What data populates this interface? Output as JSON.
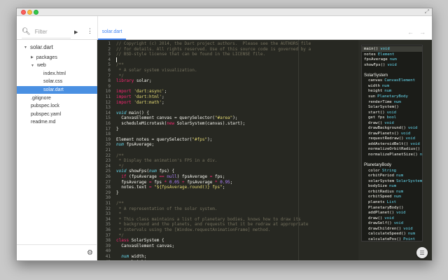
{
  "toolbar": {
    "filter_placeholder": "Filter",
    "search_icon": "search-icon",
    "run_icon": "▶",
    "more_icon": "⋮",
    "nav_back": "←",
    "nav_forward": "→",
    "expand_icon": "⤢"
  },
  "tabs": [
    {
      "label": "solar.dart",
      "active": true
    }
  ],
  "sidebar": {
    "items": [
      {
        "label": "solar.dart",
        "arrow": "▼",
        "level": 0
      },
      {
        "label": "packages",
        "arrow": "▶",
        "level": 1
      },
      {
        "label": "web",
        "arrow": "▼",
        "level": 1
      },
      {
        "label": "index.html",
        "arrow": "",
        "level": 2
      },
      {
        "label": "solar.css",
        "arrow": "",
        "level": 2
      },
      {
        "label": "solar.dart",
        "arrow": "",
        "level": 2,
        "selected": true
      },
      {
        "label": ".gitignore",
        "arrow": "",
        "level": 1
      },
      {
        "label": "pubspec.lock",
        "arrow": "",
        "level": 1
      },
      {
        "label": "pubspec.yaml",
        "arrow": "",
        "level": 1
      },
      {
        "label": "readme.md",
        "arrow": "",
        "level": 1
      }
    ],
    "settings_icon": "⚙"
  },
  "editor": {
    "lines": [
      {
        "n": "1",
        "t": [
          [
            "c-comment",
            "// Copyright (c) 2014, the Dart project authors.  Please see the AUTHORS file"
          ]
        ]
      },
      {
        "n": "2",
        "t": [
          [
            "c-comment",
            "// for details. All rights reserved. Use of this source code is governed by a"
          ]
        ]
      },
      {
        "n": "3",
        "t": [
          [
            "c-comment",
            "// BSD-style license that can be found in the LICENSE file."
          ]
        ]
      },
      {
        "n": "4",
        "t": [],
        "cursor": true
      },
      {
        "n": "5",
        "t": [
          [
            "c-comment",
            "/**"
          ]
        ]
      },
      {
        "n": "6",
        "t": [
          [
            "c-comment",
            " * A solar system visualization."
          ]
        ]
      },
      {
        "n": "7",
        "t": [
          [
            "c-comment",
            " */"
          ]
        ]
      },
      {
        "n": "8",
        "t": [
          [
            "c-kw",
            "library"
          ],
          [
            "c-plain",
            " solar;"
          ]
        ]
      },
      {
        "n": "9",
        "t": []
      },
      {
        "n": "10",
        "t": [
          [
            "c-kw",
            "import"
          ],
          [
            "c-plain",
            " "
          ],
          [
            "c-str",
            "'dart:async'"
          ],
          [
            "c-plain",
            ";"
          ]
        ]
      },
      {
        "n": "11",
        "t": [
          [
            "c-kw",
            "import"
          ],
          [
            "c-plain",
            " "
          ],
          [
            "c-str",
            "'dart:html'"
          ],
          [
            "c-plain",
            ";"
          ]
        ]
      },
      {
        "n": "12",
        "t": [
          [
            "c-kw",
            "import"
          ],
          [
            "c-plain",
            " "
          ],
          [
            "c-str",
            "'dart:math'"
          ],
          [
            "c-plain",
            ";"
          ]
        ]
      },
      {
        "n": "13",
        "t": []
      },
      {
        "n": "14",
        "t": [
          [
            "c-type",
            "void"
          ],
          [
            "c-plain",
            " main() {"
          ]
        ]
      },
      {
        "n": "15",
        "t": [
          [
            "c-plain",
            "  CanvasElement canvas = querySelector("
          ],
          [
            "c-str",
            "\"#area\""
          ],
          [
            "c-plain",
            ");"
          ]
        ]
      },
      {
        "n": "16",
        "t": [
          [
            "c-plain",
            "  scheduleMicrotask("
          ],
          [
            "c-kw",
            "new"
          ],
          [
            "c-plain",
            " SolarSystem(canvas).start);"
          ]
        ]
      },
      {
        "n": "17",
        "t": [
          [
            "c-plain",
            "}"
          ]
        ]
      },
      {
        "n": "18",
        "t": []
      },
      {
        "n": "19",
        "t": [
          [
            "c-plain",
            "Element notes = querySelector("
          ],
          [
            "c-str",
            "\"#fps\""
          ],
          [
            "c-plain",
            ");"
          ]
        ]
      },
      {
        "n": "20",
        "t": [
          [
            "c-type",
            "num"
          ],
          [
            "c-plain",
            " fpsAverage;"
          ]
        ]
      },
      {
        "n": "21",
        "t": []
      },
      {
        "n": "22",
        "t": [
          [
            "c-comment",
            "/**"
          ]
        ]
      },
      {
        "n": "23",
        "t": [
          [
            "c-comment",
            " * Display the animation's FPS in a div."
          ]
        ]
      },
      {
        "n": "24",
        "t": [
          [
            "c-comment",
            " */"
          ]
        ]
      },
      {
        "n": "25",
        "t": [
          [
            "c-type",
            "void"
          ],
          [
            "c-plain",
            " showFps("
          ],
          [
            "c-type",
            "num"
          ],
          [
            "c-plain",
            " fps) {"
          ]
        ]
      },
      {
        "n": "26",
        "t": [
          [
            "c-plain",
            "  "
          ],
          [
            "c-kw",
            "if"
          ],
          [
            "c-plain",
            " (fpsAverage "
          ],
          [
            "c-kw",
            "=="
          ],
          [
            "c-plain",
            " "
          ],
          [
            "c-num",
            "null"
          ],
          [
            "c-plain",
            ") fpsAverage "
          ],
          [
            "c-kw",
            "="
          ],
          [
            "c-plain",
            " fps;"
          ]
        ]
      },
      {
        "n": "27",
        "t": [
          [
            "c-plain",
            "  fpsAverage "
          ],
          [
            "c-kw",
            "="
          ],
          [
            "c-plain",
            " fps "
          ],
          [
            "c-kw",
            "*"
          ],
          [
            "c-plain",
            " "
          ],
          [
            "c-num",
            "0.05"
          ],
          [
            "c-plain",
            " "
          ],
          [
            "c-kw",
            "+"
          ],
          [
            "c-plain",
            " fpsAverage "
          ],
          [
            "c-kw",
            "*"
          ],
          [
            "c-plain",
            " "
          ],
          [
            "c-num",
            "0.95"
          ],
          [
            "c-plain",
            ";"
          ]
        ]
      },
      {
        "n": "28",
        "t": [
          [
            "c-plain",
            "  notes.text "
          ],
          [
            "c-kw",
            "="
          ],
          [
            "c-plain",
            " "
          ],
          [
            "c-str",
            "\"${fpsAverage.round()} fps\""
          ],
          [
            "c-plain",
            ";"
          ]
        ]
      },
      {
        "n": "29",
        "t": [
          [
            "c-plain",
            "}"
          ]
        ]
      },
      {
        "n": "30",
        "t": []
      },
      {
        "n": "31",
        "t": [
          [
            "c-comment",
            "/**"
          ]
        ]
      },
      {
        "n": "32",
        "t": [
          [
            "c-comment",
            " * A representation of the solar system."
          ]
        ]
      },
      {
        "n": "33",
        "t": [
          [
            "c-comment",
            " *"
          ]
        ]
      },
      {
        "n": "34",
        "t": [
          [
            "c-comment",
            " * This class maintains a list of planetary bodies, knows how to draw its"
          ]
        ]
      },
      {
        "n": "35",
        "t": [
          [
            "c-comment",
            " * background and the planets, and requests that it be redraw at appropriate"
          ]
        ]
      },
      {
        "n": "36",
        "t": [
          [
            "c-comment",
            " * intervals using the [Window.requestAnimationFrame] method."
          ]
        ]
      },
      {
        "n": "37",
        "t": [
          [
            "c-comment",
            " */"
          ]
        ]
      },
      {
        "n": "38",
        "t": [
          [
            "c-kw",
            "class"
          ],
          [
            "c-plain",
            " SolarSystem {"
          ]
        ]
      },
      {
        "n": "39",
        "t": [
          [
            "c-plain",
            "  CanvasElement canvas;"
          ]
        ]
      },
      {
        "n": "40",
        "t": []
      },
      {
        "n": "41",
        "t": [
          [
            "c-plain",
            "  "
          ],
          [
            "c-type",
            "num"
          ],
          [
            "c-plain",
            " width;"
          ]
        ]
      },
      {
        "n": "42",
        "t": [
          [
            "c-plain",
            "  "
          ],
          [
            "c-type",
            "num"
          ],
          [
            "c-plain",
            " height;"
          ]
        ]
      },
      {
        "n": "43",
        "t": []
      },
      {
        "n": "44",
        "t": [
          [
            "c-plain",
            "  PlanetaryBody sun;"
          ]
        ]
      }
    ]
  },
  "outline": {
    "rows": [
      {
        "name": "main()",
        "type": "void",
        "selected": true
      },
      {
        "name": "notes",
        "type": "Element"
      },
      {
        "name": "fpsAverage",
        "type": "num"
      },
      {
        "name": "showFps()",
        "type": "void"
      },
      {
        "name": "",
        "type": ""
      },
      {
        "name": "SolarSystem",
        "type": "",
        "header": true
      },
      {
        "name": "canvas",
        "type": "CanvasElement",
        "indent": true
      },
      {
        "name": "width",
        "type": "num",
        "indent": true
      },
      {
        "name": "height",
        "type": "num",
        "indent": true
      },
      {
        "name": "sun",
        "type": "PlanetaryBody",
        "indent": true
      },
      {
        "name": "renderTime",
        "type": "num",
        "indent": true
      },
      {
        "name": "SolarSystem()",
        "type": "",
        "indent": true
      },
      {
        "name": "start()",
        "type": "void",
        "indent": true
      },
      {
        "name": "get fps",
        "type": "bool",
        "indent": true
      },
      {
        "name": "draw()",
        "type": "void",
        "indent": true
      },
      {
        "name": "drawBackground()",
        "type": "void",
        "indent": true
      },
      {
        "name": "drawPlanets()",
        "type": "void",
        "indent": true
      },
      {
        "name": "requestRedraw()",
        "type": "void",
        "indent": true
      },
      {
        "name": "addAsteroidBelt()",
        "type": "void",
        "indent": true
      },
      {
        "name": "normalizeOrbitRadius()",
        "type": "",
        "indent": true
      },
      {
        "name": "normalizePlanetSize()",
        "type": "n…",
        "indent": true
      },
      {
        "name": "",
        "type": ""
      },
      {
        "name": "PlanetaryBody",
        "type": "",
        "header": true
      },
      {
        "name": "color",
        "type": "String",
        "indent": true
      },
      {
        "name": "orbitPeriod",
        "type": "num",
        "indent": true
      },
      {
        "name": "solarSystem",
        "type": "SolarSystem",
        "indent": true
      },
      {
        "name": "bodySize",
        "type": "num",
        "indent": true
      },
      {
        "name": "orbitRadius",
        "type": "num",
        "indent": true
      },
      {
        "name": "orbitSpeed",
        "type": "num",
        "indent": true
      },
      {
        "name": "planets",
        "type": "List",
        "indent": true
      },
      {
        "name": "PlanetaryBody()",
        "type": "",
        "indent": true
      },
      {
        "name": "addPlanet()",
        "type": "void",
        "indent": true
      },
      {
        "name": "draw()",
        "type": "void",
        "indent": true
      },
      {
        "name": "drawSelf()",
        "type": "void",
        "indent": true
      },
      {
        "name": "drawChildren()",
        "type": "void",
        "indent": true
      },
      {
        "name": "calculateSpeed()",
        "type": "num",
        "indent": true
      },
      {
        "name": "calculatePos()",
        "type": "Point",
        "indent": true
      }
    ],
    "fab_icon": "☰"
  }
}
